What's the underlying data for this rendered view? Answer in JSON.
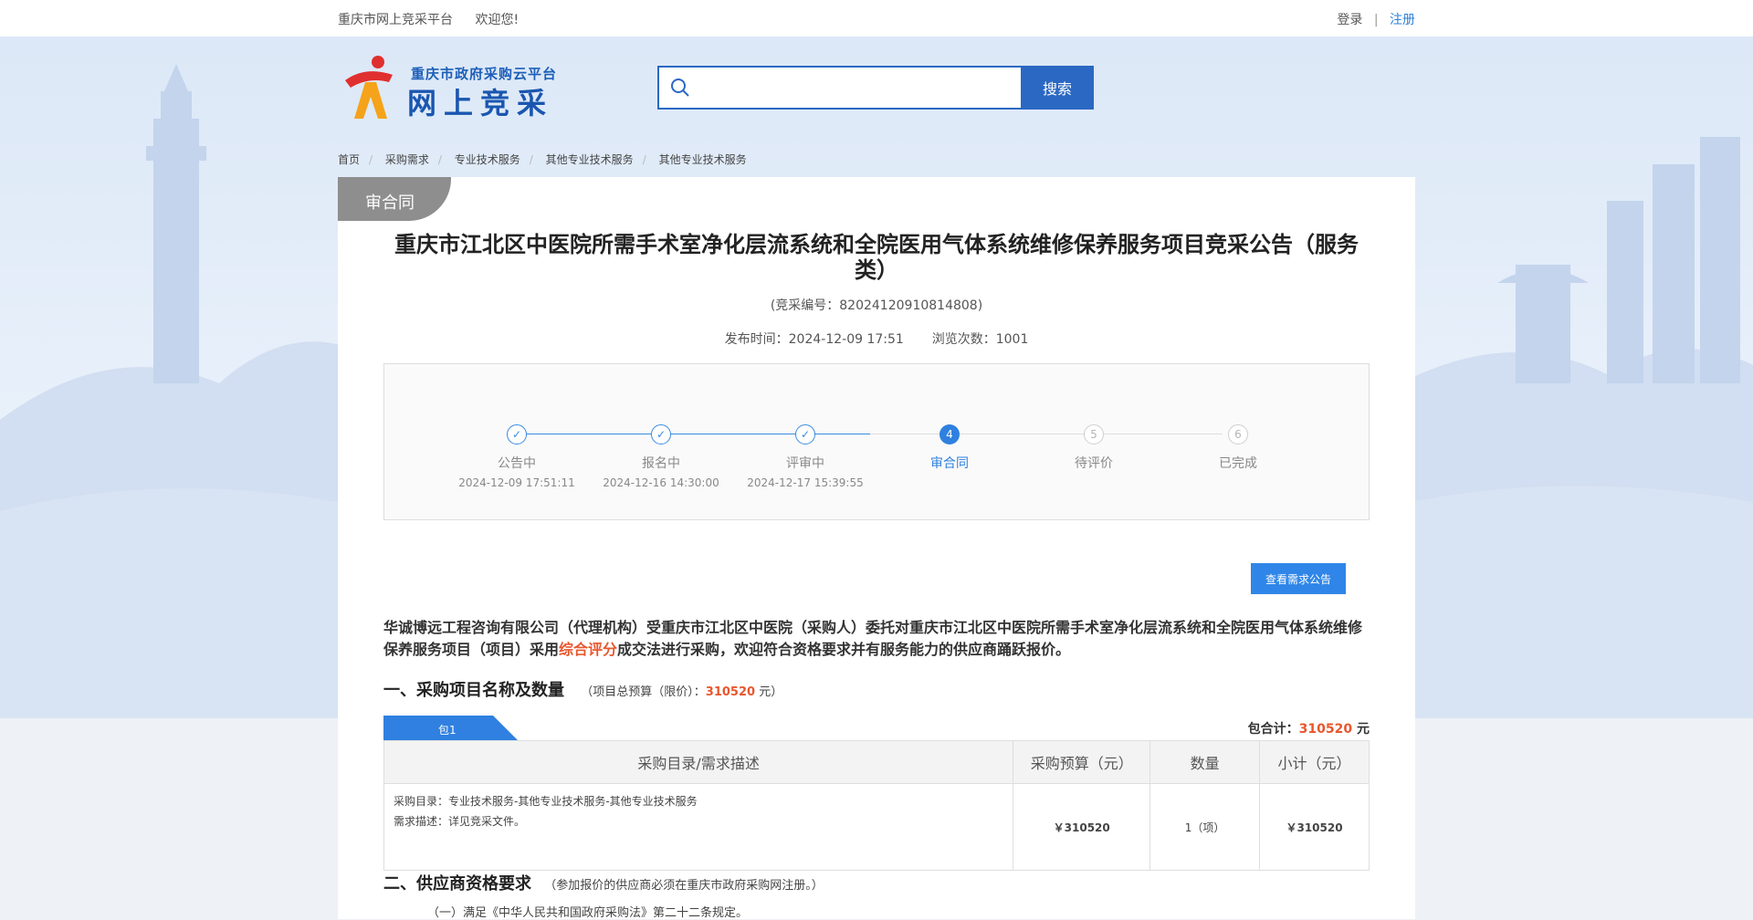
{
  "topbar": {
    "site_name": "重庆市网上竞采平台",
    "welcome": "欢迎您!",
    "login": "登录",
    "separator": "|",
    "register": "注册"
  },
  "logo": {
    "subtitle": "重庆市政府采购云平台",
    "title": "网上竞采"
  },
  "search": {
    "placeholder": "",
    "value": "",
    "button_label": "搜索",
    "icon": "search-icon"
  },
  "breadcrumb": [
    "首页",
    "采购需求",
    "专业技术服务",
    "其他专业技术服务",
    "其他专业技术服务"
  ],
  "status_tag": "审合同",
  "notice": {
    "title": "重庆市江北区中医院所需手术室净化层流系统和全院医用气体系统维修保养服务项目竞采公告（服务类）",
    "code_label": "(竞采编号：82024120910814808)",
    "publish_label": "发布时间：",
    "publish_time": "2024-12-09 17:51",
    "views_label": "浏览次数：",
    "views": "1001"
  },
  "steps": [
    {
      "label": "公告中",
      "time": "2024-12-09 17:51:11",
      "state": "done",
      "mark": "✓"
    },
    {
      "label": "报名中",
      "time": "2024-12-16 14:30:00",
      "state": "done",
      "mark": "✓"
    },
    {
      "label": "评审中",
      "time": "2024-12-17 15:39:55",
      "state": "done",
      "mark": "✓"
    },
    {
      "label": "审合同",
      "time": "",
      "state": "current",
      "mark": "4"
    },
    {
      "label": "待评价",
      "time": "",
      "state": "todo",
      "mark": "5"
    },
    {
      "label": "已完成",
      "time": "",
      "state": "todo",
      "mark": "6"
    }
  ],
  "view_request_button": "查看需求公告",
  "intro": {
    "part1": "华诚博远工程咨询有限公司（代理机构）受重庆市江北区中医院（采购人）委托对重庆市江北区中医院所需手术室净化层流系统和全院医用气体系统维修保养服务项目（项目）采用",
    "highlight": "综合评分",
    "part2": "成交法进行采购，欢迎符合资格要求并有服务能力的供应商踊跃报价。"
  },
  "section1": {
    "title": "一、采购项目名称及数量",
    "budget_prefix": "（项目总预算（限价）：",
    "budget_value": "310520",
    "budget_suffix": " 元）"
  },
  "package": {
    "tab": "包1",
    "sum_label": "包合计：",
    "sum_value": "310520",
    "sum_unit": " 元"
  },
  "table": {
    "headers": [
      "采购目录/需求描述",
      "采购预算（元）",
      "数量",
      "小计（元）"
    ],
    "rows": [
      {
        "catalog": "采购目录：专业技术服务-其他专业技术服务-其他专业技术服务",
        "description": "需求描述：详见竞采文件。",
        "budget": "￥310520",
        "quantity": "1（项）",
        "subtotal": "￥310520"
      }
    ]
  },
  "section2": {
    "title": "二、供应商资格要求",
    "note": "（参加报价的供应商必须在重庆市政府采购网注册。）",
    "item1": "（一）满足《中华人民共和国政府采购法》第二十二条规定。"
  },
  "colors": {
    "primary": "#2b68c3",
    "accent_blue": "#2f80e0",
    "highlight_red": "#e8572e",
    "tag_gray": "#8e8e8e"
  }
}
